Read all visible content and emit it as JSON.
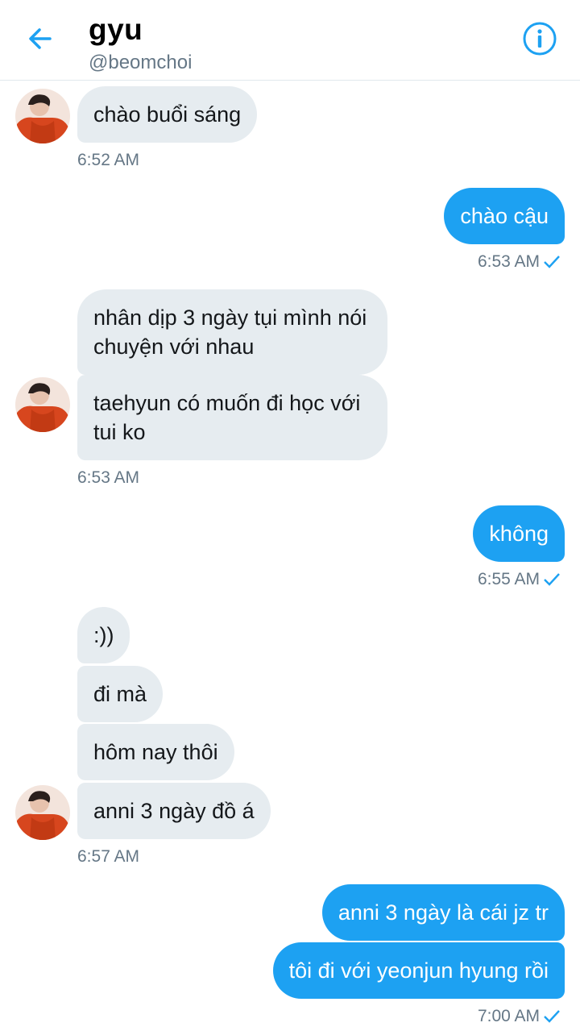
{
  "header": {
    "title": "gyu",
    "handle": "@beomchoi",
    "back_icon": "arrow-left-icon",
    "info_icon": "info-icon",
    "accent": "#1da1f2"
  },
  "messages": [
    {
      "side": "in",
      "text": "chào buổi sáng"
    },
    {
      "side": "out",
      "text": "chào cậu"
    },
    {
      "side": "in",
      "text": "nhân dịp 3 ngày tụi mình nói chuyện với nhau"
    },
    {
      "side": "in",
      "text": "taehyun có muốn đi học với tui ko"
    },
    {
      "side": "out",
      "text": "không"
    },
    {
      "side": "in",
      "text": ":))"
    },
    {
      "side": "in",
      "text": "đi mà"
    },
    {
      "side": "in",
      "text": "hôm nay thôi"
    },
    {
      "side": "in",
      "text": "anni 3 ngày đồ á"
    },
    {
      "side": "out",
      "text": "anni 3 ngày là cái jz tr"
    },
    {
      "side": "out",
      "text": "tôi đi với yeonjun hyung rồi"
    }
  ],
  "timestamps": [
    "6:52 AM",
    "6:53 AM",
    "6:53 AM",
    "6:55 AM",
    "6:57 AM",
    "7:00 AM"
  ],
  "colors": {
    "incoming_bubble": "#e6ecf0",
    "outgoing_bubble": "#1da1f2",
    "meta_text": "#657786"
  }
}
